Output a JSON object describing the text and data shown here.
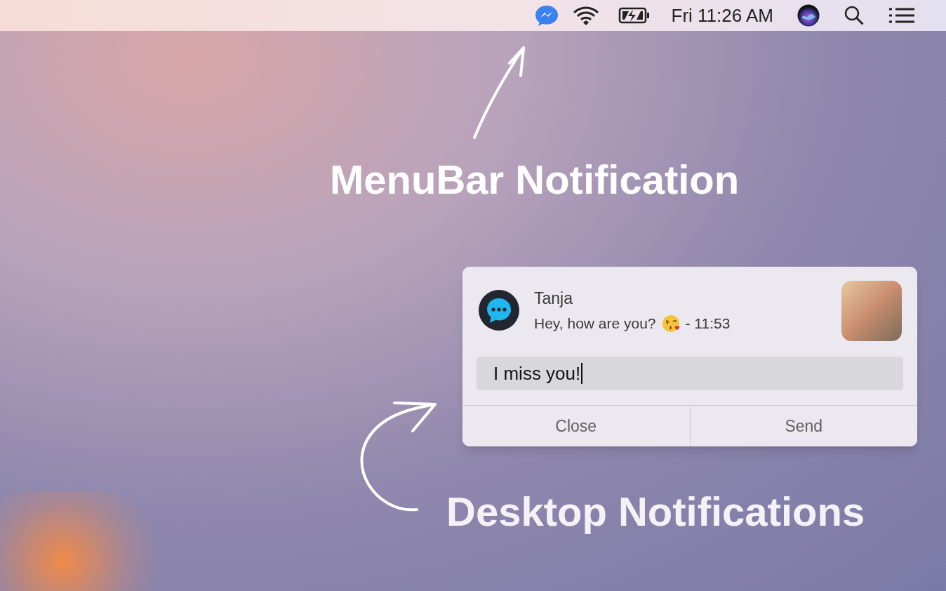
{
  "menu_bar": {
    "clock": "Fri 11:26 AM"
  },
  "annotations": [
    {
      "label": "MenuBar Notification"
    },
    {
      "label": "Desktop Notifications"
    }
  ],
  "notification": {
    "sender": "Tanja",
    "message_before": "Hey, how are you?",
    "message_after": "- 11:53",
    "reply": {
      "value": "I miss you!"
    },
    "buttons": [
      "Close",
      "Send"
    ]
  }
}
